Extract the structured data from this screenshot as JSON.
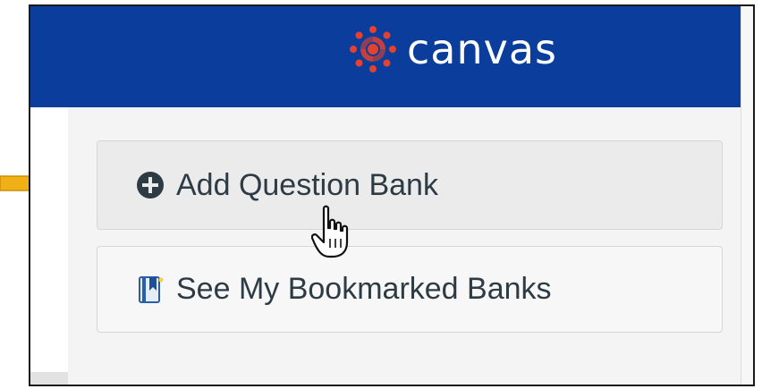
{
  "header": {
    "brand_name": "canvas",
    "logo_icon": "canvas-logo-icon",
    "brand_color": "#0b3d9c",
    "logo_color": "#e4412f"
  },
  "actions": {
    "add_question_bank": {
      "label": "Add Question Bank",
      "icon": "plus-circle-icon"
    },
    "see_bookmarked_banks": {
      "label": "See My Bookmarked Banks",
      "icon": "bookmark-book-icon"
    }
  },
  "annotations": {
    "pointer_arrow_color": "#f2b017",
    "cursor_icon": "hand-pointer-cursor-icon"
  }
}
